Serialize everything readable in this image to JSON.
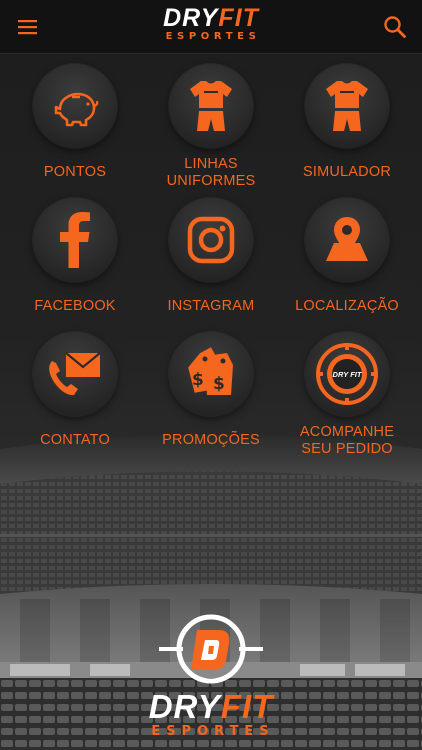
{
  "header": {
    "brand_word_1": "DRY",
    "brand_word_2": "FIT",
    "brand_sub": "ESPORTES"
  },
  "menu": {
    "items": [
      {
        "label_line1": "PONTOS",
        "label_line2": "",
        "icon": "piggy-bank-icon"
      },
      {
        "label_line1": "LINHAS",
        "label_line2": "UNIFORMES",
        "icon": "uniform-icon"
      },
      {
        "label_line1": "SIMULADOR",
        "label_line2": "",
        "icon": "uniform-icon"
      },
      {
        "label_line1": "FACEBOOK",
        "label_line2": "",
        "icon": "facebook-icon"
      },
      {
        "label_line1": "INSTAGRAM",
        "label_line2": "",
        "icon": "instagram-icon"
      },
      {
        "label_line1": "LOCALIZAÇÃO",
        "label_line2": "",
        "icon": "location-pin-icon"
      },
      {
        "label_line1": "CONTATO",
        "label_line2": "",
        "icon": "phone-envelope-icon"
      },
      {
        "label_line1": "PROMOÇÕES",
        "label_line2": "",
        "icon": "price-tag-icon"
      },
      {
        "label_line1": "ACOMPANHE",
        "label_line2": "SEU PEDIDO",
        "icon": "order-tracking-icon"
      }
    ]
  },
  "footer_logo": {
    "brand_word_1": "DRY",
    "brand_word_2": "FIT",
    "brand_sub": "ESPORTES",
    "emblem_letter": "D"
  },
  "order_badge": {
    "text": "DRY FIT"
  },
  "colors": {
    "accent": "#f5661f",
    "background": "#1b1b1b",
    "header": "#121212"
  }
}
